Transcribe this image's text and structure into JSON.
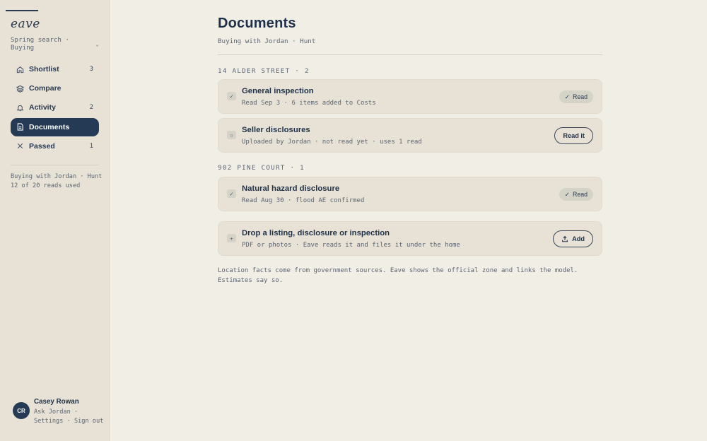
{
  "app": {
    "logo": "eave"
  },
  "sidebar": {
    "search_selector": "Spring search · Buying",
    "items": [
      {
        "label": "Shortlist",
        "count": "3",
        "icon": "home-icon"
      },
      {
        "label": "Compare",
        "count": "",
        "icon": "layers-icon"
      },
      {
        "label": "Activity",
        "count": "2",
        "icon": "bell-icon"
      },
      {
        "label": "Documents",
        "count": "",
        "icon": "document-icon"
      },
      {
        "label": "Passed",
        "count": "1",
        "icon": "close-icon"
      }
    ],
    "note_line1": "Buying with Jordan · Hunt",
    "note_line2": "12 of 20 reads used",
    "user": {
      "initials": "CR",
      "name": "Casey Rowan",
      "ask": "Ask Jordan",
      "settings": "Settings",
      "sign_out": "Sign out"
    }
  },
  "main": {
    "title": "Documents",
    "subtitle": "Buying with Jordan · Hunt",
    "sections": [
      {
        "label": "14 ALDER STREET · 2",
        "docs": [
          {
            "status": "✓",
            "title": "General inspection",
            "meta": "Read Sep 3 · 6 items added to Costs",
            "action": "Read",
            "action_type": "pill"
          },
          {
            "status": "○",
            "title": "Seller disclosures",
            "meta": "Uploaded by Jordan · not read yet · uses 1 read",
            "action": "Read it",
            "action_type": "button"
          }
        ]
      },
      {
        "label": "902 PINE COURT · 1",
        "docs": [
          {
            "status": "✓",
            "title": "Natural hazard disclosure",
            "meta": "Read Aug 30 · flood AE confirmed",
            "action": "Read",
            "action_type": "pill"
          }
        ]
      }
    ],
    "dropzone": {
      "icon": "+",
      "title": "Drop a listing, disclosure or inspection",
      "meta": "PDF or photos · Eave reads it and files it under the home",
      "action": "Add"
    },
    "footnote": "Location facts come from government sources. Eave shows the official zone and links the model. Estimates say so."
  },
  "colors": {
    "accent": "#243a55",
    "background": "#f1eee6",
    "sidebar": "#e8e2d6",
    "card": "#e8e2d6"
  }
}
